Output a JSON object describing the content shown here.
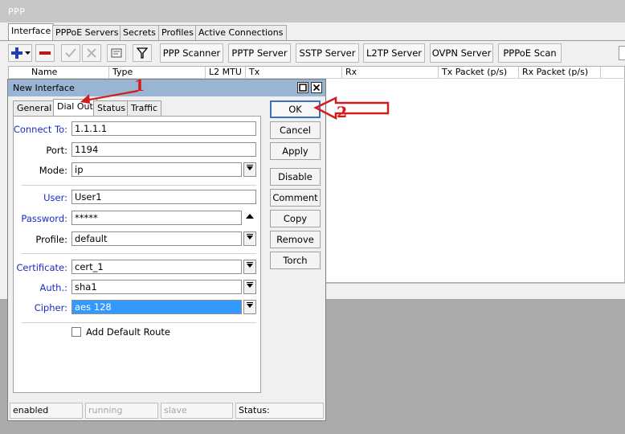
{
  "window": {
    "title": "PPP",
    "tabs": [
      "Interface",
      "PPPoE Servers",
      "Secrets",
      "Profiles",
      "Active Connections"
    ],
    "active_tab": "Interface",
    "toolbar_buttons": [
      "PPP Scanner",
      "PPTP Server",
      "SSTP Server",
      "L2TP Server",
      "OVPN Server",
      "PPPoE Scan"
    ],
    "toolbar_icons": [
      "add-icon",
      "remove-icon",
      "enable-icon",
      "disable-icon",
      "comment-icon",
      "filter-icon"
    ],
    "columns": [
      "Name",
      "Type",
      "L2 MTU",
      "Tx",
      "Rx",
      "Tx Packet (p/s)",
      "Rx Packet (p/s)"
    ]
  },
  "dialog": {
    "title": "New Interface",
    "tabs": [
      "General",
      "Dial Out",
      "Status",
      "Traffic"
    ],
    "active_tab": "Dial Out",
    "fields": {
      "connect_to": {
        "label": "Connect To:",
        "value": "1.1.1.1"
      },
      "port": {
        "label": "Port:",
        "value": "1194"
      },
      "mode": {
        "label": "Mode:",
        "value": "ip"
      },
      "user": {
        "label": "User:",
        "value": "User1"
      },
      "password": {
        "label": "Password:",
        "value": "*****"
      },
      "profile": {
        "label": "Profile:",
        "value": "default"
      },
      "certificate": {
        "label": "Certificate:",
        "value": "cert_1"
      },
      "auth": {
        "label": "Auth.:",
        "value": "sha1"
      },
      "cipher": {
        "label": "Cipher:",
        "value": "aes 128"
      }
    },
    "checkbox": {
      "label": "Add Default Route",
      "checked": false
    },
    "buttons": [
      "OK",
      "Cancel",
      "Apply",
      "Disable",
      "Comment",
      "Copy",
      "Remove",
      "Torch"
    ],
    "status_bar": [
      "enabled",
      "running",
      "slave",
      "Status:"
    ]
  },
  "annotations": {
    "step1": "1",
    "step2": "2",
    "color": "#d21d1d"
  }
}
